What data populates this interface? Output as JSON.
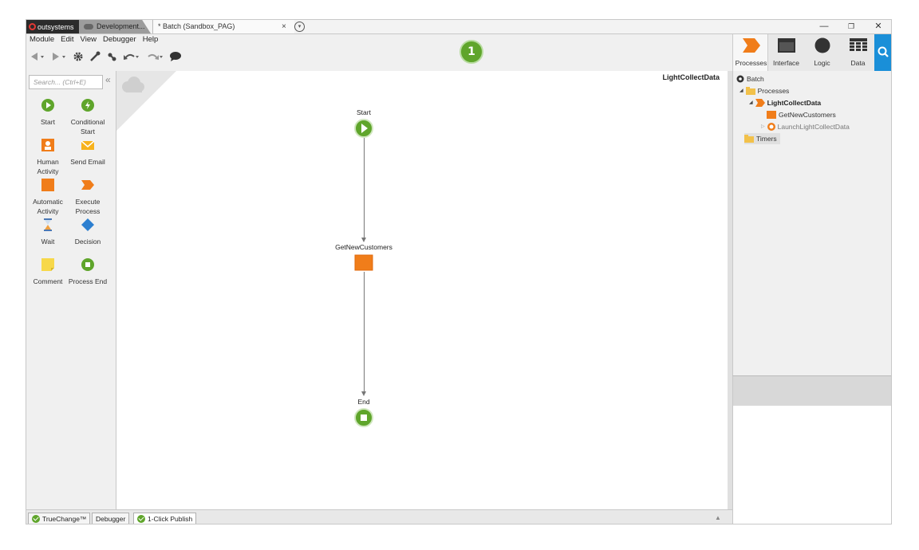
{
  "title_bar": {
    "logo_text": "outsystems",
    "tab_dev": "Development...",
    "tab_batch": "* Batch (Sandbox_PAG)",
    "tab_close": "×",
    "tab_more": "▾",
    "win_min": "—",
    "win_restore": "❐",
    "win_close": "✕"
  },
  "menu": [
    "Module",
    "Edit",
    "View",
    "Debugger",
    "Help"
  ],
  "publish_badge": "1",
  "right_tabs": [
    {
      "label": "Processes",
      "icon": "process-icon"
    },
    {
      "label": "Interface",
      "icon": "interface-icon"
    },
    {
      "label": "Logic",
      "icon": "logic-icon"
    },
    {
      "label": "Data",
      "icon": "data-icon"
    }
  ],
  "palette": {
    "search_placeholder": "Search... (Ctrl+E)",
    "collapse": "«",
    "items": [
      {
        "l1": "Start",
        "l2": ""
      },
      {
        "l1": "Conditional",
        "l2": "Start"
      },
      {
        "l1": "Human",
        "l2": "Activity"
      },
      {
        "l1": "Send Email",
        "l2": ""
      },
      {
        "l1": "Automatic",
        "l2": "Activity"
      },
      {
        "l1": "Execute",
        "l2": "Process"
      },
      {
        "l1": "Wait",
        "l2": ""
      },
      {
        "l1": "Decision",
        "l2": ""
      },
      {
        "l1": "Comment",
        "l2": ""
      },
      {
        "l1": "Process End",
        "l2": ""
      }
    ]
  },
  "canvas": {
    "process_name": "LightCollectData",
    "start_label": "Start",
    "activity_label": "GetNewCustomers",
    "end_label": "End"
  },
  "tree": {
    "root": "Batch",
    "processes": "Processes",
    "process": "LightCollectData",
    "activity": "GetNewCustomers",
    "launch": "LaunchLightCollectData",
    "timers": "Timers"
  },
  "bottom_tabs": [
    "TrueChange™",
    "Debugger",
    "1-Click Publish"
  ],
  "colors": {
    "green": "#5fa52b",
    "orange": "#f07d1a",
    "blue": "#1a8fd8"
  }
}
